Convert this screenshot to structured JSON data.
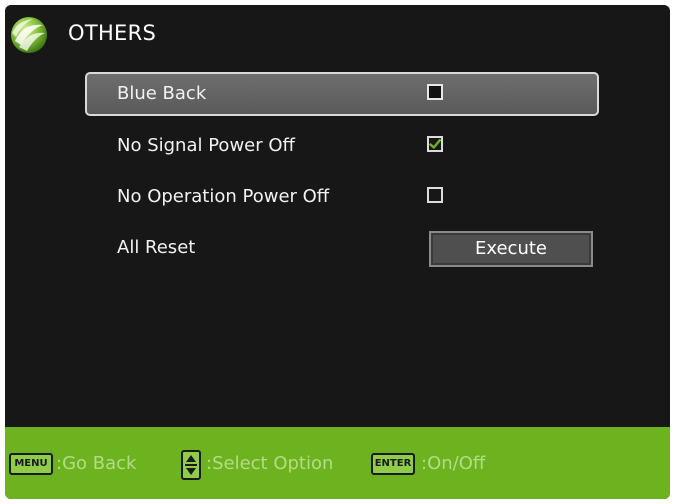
{
  "header": {
    "title": "OTHERS",
    "logo_icon": "green-sphere-logo"
  },
  "menu": {
    "items": [
      {
        "label": "Blue Back",
        "control": "checkbox",
        "checked": false,
        "selected": true
      },
      {
        "label": "No Signal Power Off",
        "control": "checkbox",
        "checked": true,
        "selected": false
      },
      {
        "label": "No Operation Power Off",
        "control": "checkbox",
        "checked": false,
        "selected": false
      },
      {
        "label": "All Reset",
        "control": "button",
        "button_label": "Execute",
        "selected": false
      }
    ]
  },
  "footer": {
    "hints": [
      {
        "key": "MENU",
        "text": ":Go Back"
      },
      {
        "key_icon": "up-down-arrows-icon",
        "text": ":Select Option"
      },
      {
        "key": "ENTER",
        "text": ":On/Off"
      }
    ]
  },
  "colors": {
    "background": "#171717",
    "footer": "#6db31f",
    "checkmark": "#6db31f",
    "selected_row": "#666666"
  }
}
